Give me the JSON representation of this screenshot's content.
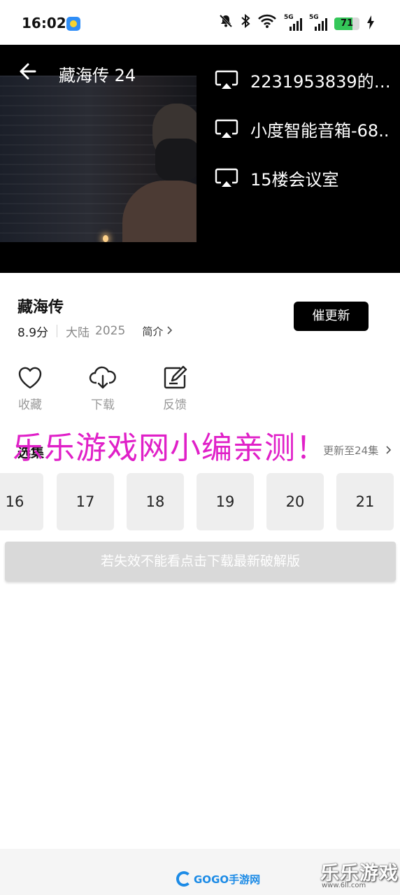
{
  "status_bar": {
    "time": "16:02",
    "app_icon": "app-notification-icon",
    "icons": [
      "bell-off-icon",
      "bluetooth-icon",
      "wifi-icon",
      "signal-5g-icon",
      "signal-5g-icon"
    ],
    "signal_tag": "5G",
    "battery_level": "71",
    "battery_fraction": 0.71,
    "charging": true
  },
  "player": {
    "title": "藏海传 24",
    "back_icon": "back-arrow-icon",
    "cast_icon": "cast-screen-icon",
    "cast_devices": [
      {
        "label": "2231953839的电.."
      },
      {
        "label": "小度智能音箱-68.."
      },
      {
        "label": "15楼会议室"
      }
    ]
  },
  "show": {
    "title": "藏海传",
    "score": "8.9分",
    "region": "大陆",
    "year": "2025",
    "intro_link": "简介",
    "urge_button": "催更新"
  },
  "actions": [
    {
      "label": "收藏",
      "icon": "heart-icon"
    },
    {
      "label": "下载",
      "icon": "cloud-download-icon"
    },
    {
      "label": "反馈",
      "icon": "feedback-edit-icon"
    }
  ],
  "watermark_text": "乐乐游戏网小编亲测！",
  "episodes": {
    "heading": "选集",
    "update_status": "更新至24集",
    "items": [
      "16",
      "17",
      "18",
      "19",
      "20",
      "21"
    ]
  },
  "download_tip": "若失效不能看点击下载最新破解版",
  "footer": {
    "logo_text": "GOGO手游网",
    "corner_brand": "乐乐游戏",
    "corner_url": "www.6ll.com"
  },
  "colors": {
    "accent_black": "#000000",
    "watermark": "#e020c8",
    "battery": "#34c759",
    "logo_blue": "#1c8be6"
  }
}
